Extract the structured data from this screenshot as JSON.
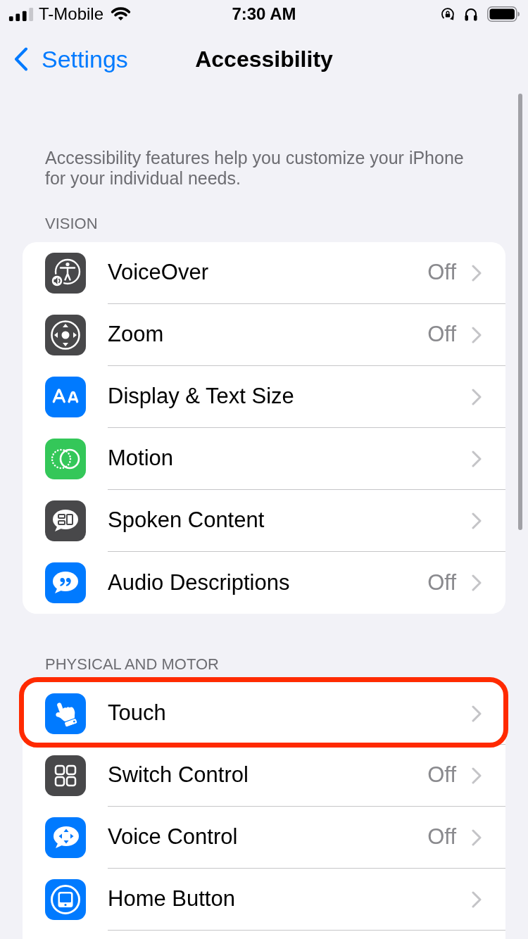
{
  "status_bar": {
    "carrier": "T-Mobile",
    "time": "7:30 AM"
  },
  "nav_bar": {
    "back": "Settings",
    "title": "Accessibility"
  },
  "intro": "Accessibility features help you customize your iPhone for your individual needs.",
  "sections": [
    {
      "header": "VISION",
      "more_below": false,
      "rows": [
        {
          "kind": "voiceover",
          "label": "VoiceOver",
          "value": "Off",
          "color": "#48484a",
          "highlighted": false
        },
        {
          "kind": "zoom",
          "label": "Zoom",
          "value": "Off",
          "color": "#48484a",
          "highlighted": false
        },
        {
          "kind": "display",
          "label": "Display & Text Size",
          "color": "#007aff",
          "highlighted": false
        },
        {
          "kind": "motion",
          "label": "Motion",
          "color": "#34c759",
          "highlighted": false
        },
        {
          "kind": "spoken",
          "label": "Spoken Content",
          "color": "#48484a",
          "highlighted": false
        },
        {
          "kind": "audio",
          "label": "Audio Descriptions",
          "value": "Off",
          "color": "#007aff",
          "highlighted": false
        }
      ]
    },
    {
      "header": "PHYSICAL AND MOTOR",
      "more_below": true,
      "rows": [
        {
          "kind": "touch",
          "label": "Touch",
          "color": "#007aff",
          "highlighted": true
        },
        {
          "kind": "switch",
          "label": "Switch Control",
          "value": "Off",
          "color": "#48484a",
          "highlighted": false
        },
        {
          "kind": "voicecontrol",
          "label": "Voice Control",
          "value": "Off",
          "color": "#007aff",
          "highlighted": false
        },
        {
          "kind": "home",
          "label": "Home Button",
          "color": "#007aff",
          "highlighted": false
        }
      ]
    }
  ]
}
